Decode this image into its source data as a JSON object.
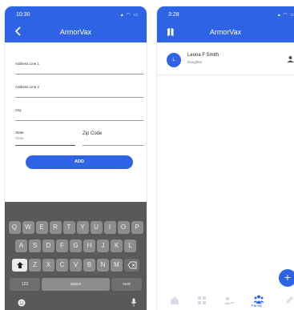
{
  "left": {
    "status_time": "10:30",
    "status_icons": "▴ ◠ ▭",
    "title": "ArmorVax",
    "form": {
      "address1_label": "Address Line 1",
      "address2_label": "Address Line 2",
      "city_label": "City",
      "state_label": "State",
      "state_placeholder": "State",
      "zip_label": "Zip Code",
      "add_button": "ADD"
    },
    "keyboard": {
      "row1": [
        "Q",
        "W",
        "E",
        "R",
        "T",
        "Y",
        "U",
        "I",
        "O",
        "P"
      ],
      "row2": [
        "A",
        "S",
        "D",
        "F",
        "G",
        "H",
        "J",
        "K",
        "L"
      ],
      "row3": [
        "Z",
        "X",
        "C",
        "V",
        "B",
        "N",
        "M"
      ],
      "num_key": "123",
      "space_key": "space",
      "next_key": "next"
    }
  },
  "right": {
    "status_time": "3:28",
    "status_icons": "▴ ◠ ▭",
    "title": "ArmorVax",
    "contact": {
      "initial": "L",
      "name": "Leona F Smith",
      "relation": "Daughter"
    },
    "fab_label": "+",
    "nav": {
      "family_label": "Family"
    }
  },
  "colors": {
    "primary": "#2f63e6",
    "keyboard_bg": "#595959",
    "key_bg": "#8d8d8d"
  }
}
